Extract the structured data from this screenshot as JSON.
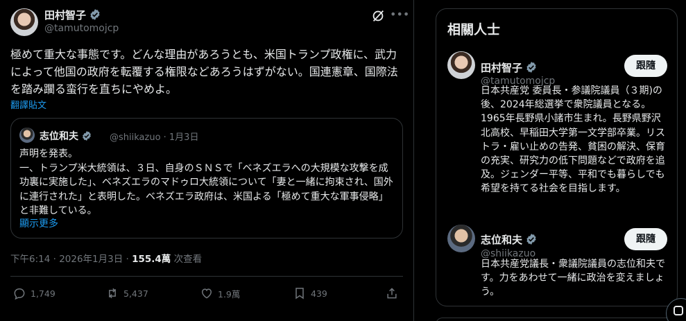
{
  "post": {
    "author_name": "田村智子",
    "author_handle": "@tamutomojcp",
    "text": "極めて重大な事態です。どんな理由があろうとも、米国トランプ政権に、武力によって他国の政府を転覆する権限などあろうはずがない。国連憲章、国際法を踏み躙る蛮行を直ちにやめよ。",
    "translate_label": "翻譯貼文",
    "quote": {
      "name": "志位和夫",
      "handle": "@shiikazuo · 1月3日",
      "text": "声明を発表。\n一、トランプ米大統領は、３日、自身のＳＮＳで「ベネズエラへの大規模な攻撃を成功裏に実施した」、ベネズエラのマドゥロ大統領について「妻と一緒に拘束され、国外に連行された」と表明した。ベネズエラ政府は、米国よる「極めて重大な軍事侵略」と非難している。",
      "more_label": "顯示更多"
    },
    "time": "下午6:14 · 2026年1月3日 · ",
    "views": "155.4萬",
    "views_label": " 次查看",
    "stats": {
      "replies": "1,749",
      "reposts": "5,437",
      "likes": "1.9萬",
      "bookmarks": "439"
    }
  },
  "sidebar": {
    "title": "相關人士",
    "follow_label": "跟隨",
    "people": [
      {
        "name": "田村智子",
        "handle": "@tamutomojcp",
        "bio": "日本共産党 委員長・参議院議員（３期)の後、2024年総選挙で衆院議員となる。1965年長野県小諸市生まれ。長野県野沢北高校、早稲田大学第一文学部卒業。リストラ・雇い止めの告発、貧困の解決、保育の充実、研究力の低下問題などで政府を追及。ジェンダー平等、平和でも暮らしでも希望を持てる社会を目指します。"
      },
      {
        "name": "志位和夫",
        "handle": "@shiikazuo",
        "bio": "日本共産党議長・衆議院議員の志位和夫です。力をあわせて一緒に政治を変えましょう。"
      }
    ]
  },
  "colors": {
    "background": "#000000",
    "text": "#e7e9ea",
    "muted": "#71767b",
    "accent": "#1d9bf0",
    "border": "#2f3336",
    "verified": "#829aab"
  }
}
